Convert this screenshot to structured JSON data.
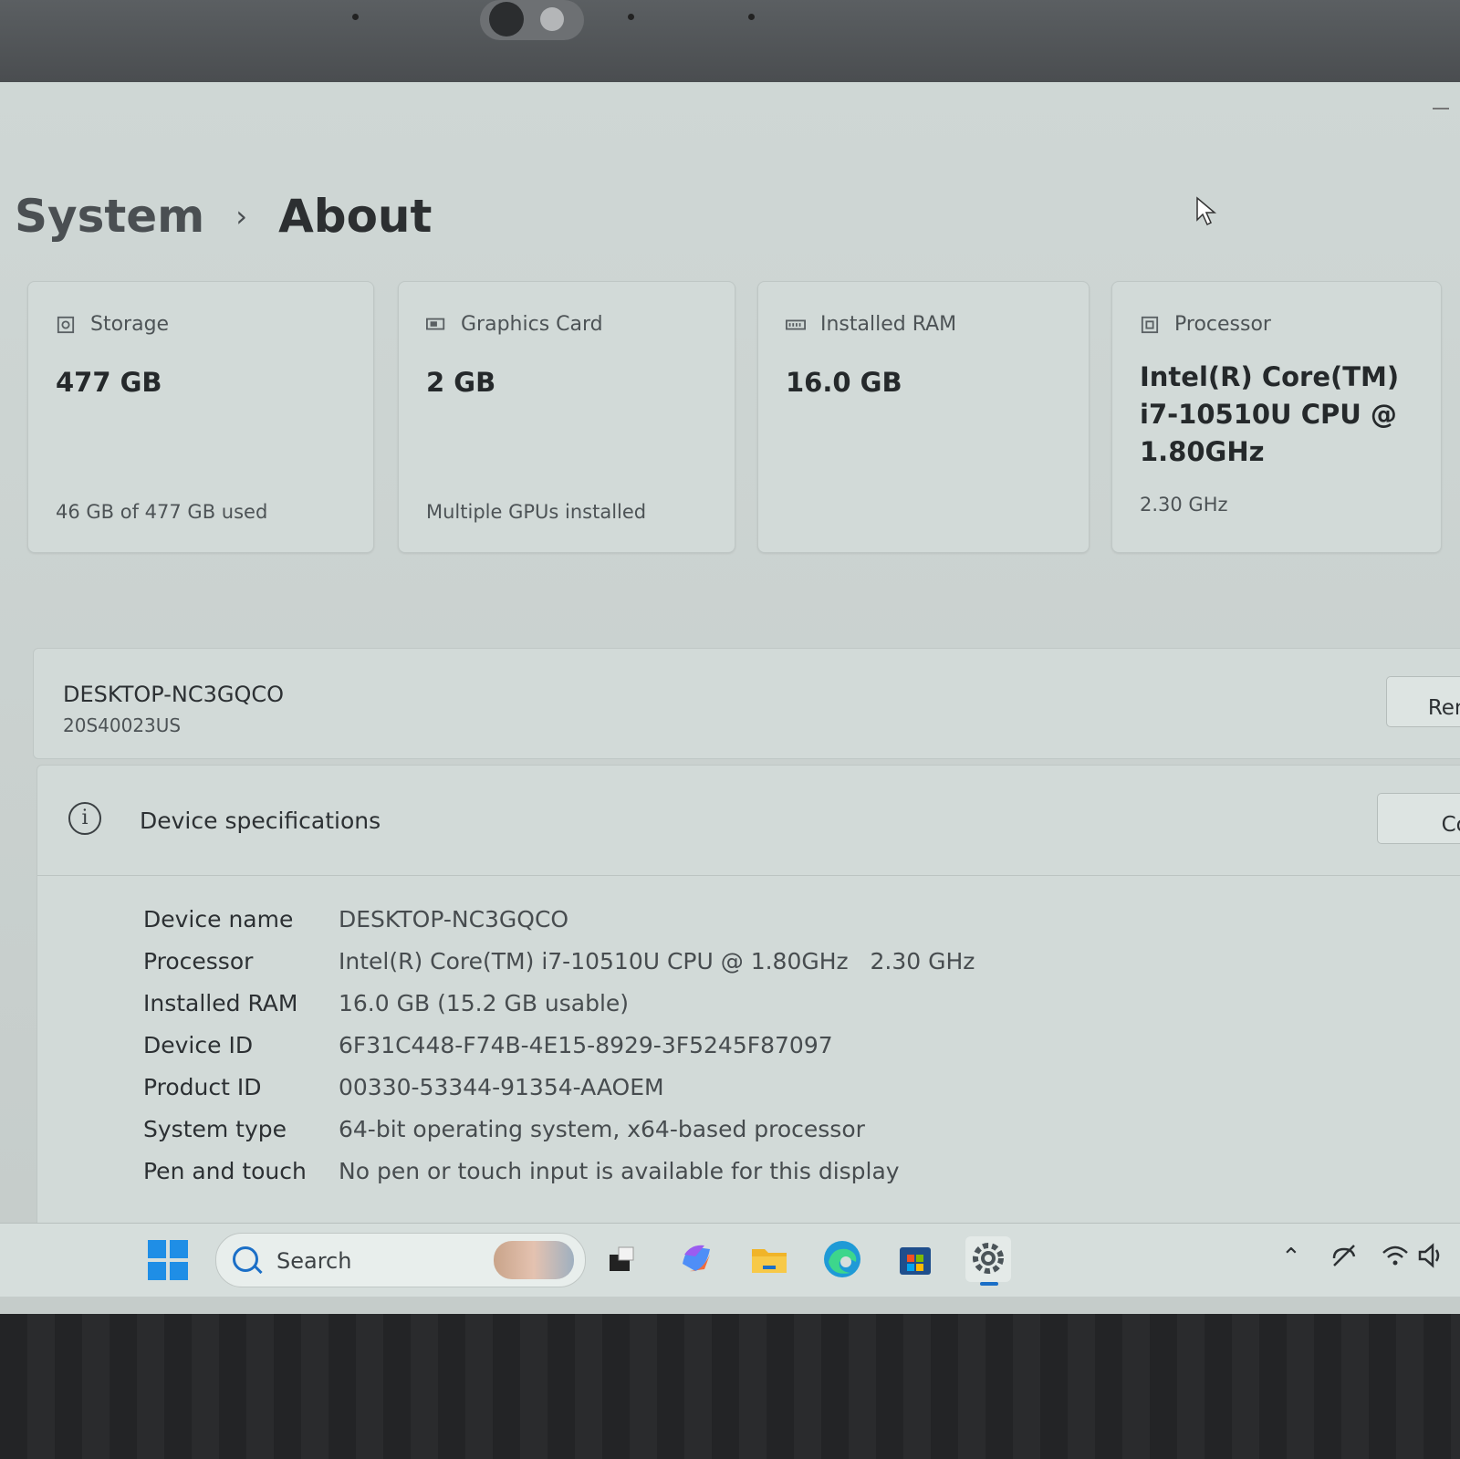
{
  "breadcrumb": {
    "parent": "System",
    "separator": "›",
    "current": "About"
  },
  "cards": [
    {
      "icon": "storage-icon",
      "label": "Storage",
      "value": "477 GB",
      "sub": "46 GB of 477 GB used"
    },
    {
      "icon": "graphics-card-icon",
      "label": "Graphics Card",
      "value": "2 GB",
      "sub": "Multiple GPUs installed"
    },
    {
      "icon": "ram-icon",
      "label": "Installed RAM",
      "value": "16.0 GB",
      "sub": ""
    },
    {
      "icon": "processor-icon",
      "label": "Processor",
      "value": "Intel(R) Core(TM) i7-10510U CPU @ 1.80GHz",
      "sub": "2.30 GHz"
    }
  ],
  "device": {
    "name": "DESKTOP-NC3GQCO",
    "model": "20S40023US",
    "rename_label": "Rename"
  },
  "specs": {
    "title": "Device specifications",
    "copy_label": "Cop",
    "rows": [
      {
        "key": "Device name",
        "value": "DESKTOP-NC3GQCO"
      },
      {
        "key": "Processor",
        "value": "Intel(R) Core(TM) i7-10510U CPU @ 1.80GHz   2.30 GHz"
      },
      {
        "key": "Installed RAM",
        "value": "16.0 GB (15.2 GB usable)"
      },
      {
        "key": "Device ID",
        "value": "6F31C448-F74B-4E15-8929-3F5245F87097"
      },
      {
        "key": "Product ID",
        "value": "00330-53344-91354-AAOEM"
      },
      {
        "key": "System type",
        "value": "64-bit operating system, x64-based processor"
      },
      {
        "key": "Pen and touch",
        "value": "No pen or touch input is available for this display"
      }
    ]
  },
  "taskbar": {
    "search_label": "Search",
    "apps": [
      "task-view-icon",
      "copilot-icon",
      "file-explorer-icon",
      "edge-icon",
      "microsoft-store-icon",
      "settings-icon"
    ],
    "active_app": "settings-icon",
    "tray": [
      "chevron-up-icon",
      "sync-off-icon",
      "wifi-icon",
      "volume-icon"
    ]
  }
}
